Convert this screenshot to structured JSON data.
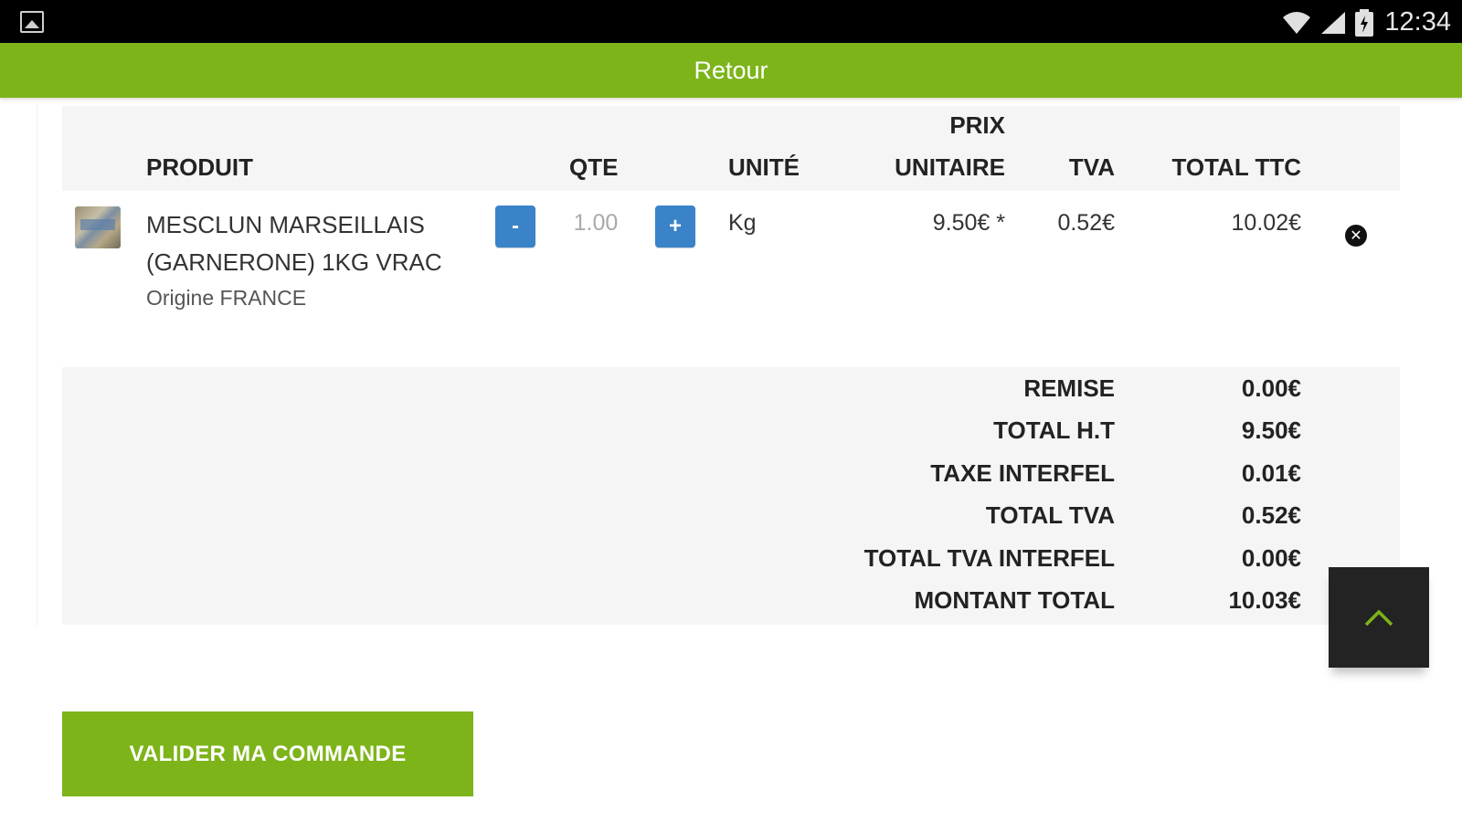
{
  "statusbar": {
    "time": "12:34"
  },
  "topbar": {
    "back_label": "Retour"
  },
  "table": {
    "headers": {
      "product": "PRODUIT",
      "qty": "QTE",
      "unit": "UNITÉ",
      "unit_price_line1": "PRIX",
      "unit_price_line2": "UNITAIRE",
      "vat": "TVA",
      "total": "TOTAL TTC"
    },
    "items": [
      {
        "name": "MESCLUN MARSEILLAIS (GARNERONE) 1KG VRAC",
        "origin": "Origine FRANCE",
        "qty": "1.00",
        "unit": "Kg",
        "unit_price": "9.50€ *",
        "vat": "0.52€",
        "total": "10.02€",
        "minus_label": "-",
        "plus_label": "+"
      }
    ]
  },
  "totals": [
    {
      "label": "REMISE",
      "value": "0.00€"
    },
    {
      "label": "TOTAL H.T",
      "value": "9.50€"
    },
    {
      "label": "TAXE INTERFEL",
      "value": "0.01€"
    },
    {
      "label": "TOTAL TVA",
      "value": "0.52€"
    },
    {
      "label": "TOTAL TVA INTERFEL",
      "value": "0.00€"
    },
    {
      "label": "MONTANT TOTAL",
      "value": "10.03€"
    }
  ],
  "actions": {
    "validate_label": "VALIDER MA COMMANDE"
  },
  "icons": {
    "gallery": "gallery-icon",
    "wifi": "wifi-icon",
    "signal": "signal-icon",
    "battery": "battery-icon",
    "remove": "close-circle-icon",
    "scroll_top": "chevron-up-icon"
  },
  "colors": {
    "accent": "#7db41a",
    "button_blue": "#3a83c9",
    "scroll_button": "#232323"
  }
}
